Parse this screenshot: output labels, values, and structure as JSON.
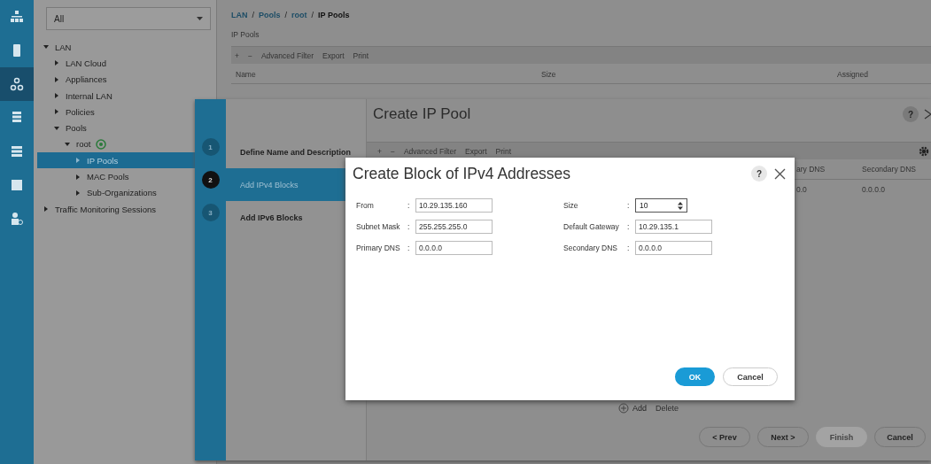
{
  "nav_icons": [
    {
      "selected": false
    },
    {
      "selected": false
    },
    {
      "selected": true
    },
    {
      "selected": false
    },
    {
      "selected": false
    },
    {
      "selected": false
    },
    {
      "selected": false
    }
  ],
  "filter": {
    "value": "All"
  },
  "tree": [
    {
      "label": "LAN",
      "expanded": true,
      "selected": false,
      "children": [
        {
          "label": "LAN Cloud",
          "expanded": false,
          "selected": false
        },
        {
          "label": "Appliances",
          "expanded": false,
          "selected": false
        },
        {
          "label": "Internal LAN",
          "expanded": false,
          "selected": false
        },
        {
          "label": "Policies",
          "expanded": false,
          "selected": false
        },
        {
          "label": "Pools",
          "expanded": true,
          "selected": false,
          "children": [
            {
              "label": "root",
              "expanded": true,
              "selected": false,
              "kind": "org",
              "children": [
                {
                  "label": "IP Pools",
                  "expanded": false,
                  "selected": true
                },
                {
                  "label": "MAC Pools",
                  "expanded": false,
                  "selected": false
                },
                {
                  "label": "Sub-Organizations",
                  "expanded": false,
                  "selected": false
                }
              ]
            }
          ]
        }
      ]
    },
    {
      "label": "Traffic Monitoring Sessions",
      "expanded": false,
      "selected": false
    }
  ],
  "breadcrumb": [
    "LAN",
    "Pools",
    "root",
    "IP Pools"
  ],
  "breadcrumb_separator": "/",
  "section_title": "IP Pools",
  "toolbar": {
    "add": "+",
    "remove": "−",
    "filter": "Advanced Filter",
    "export": "Export",
    "print": "Print"
  },
  "table": {
    "columns": [
      "Name",
      "Size",
      "Assigned"
    ]
  },
  "wizard": {
    "title": "Create IP Pool",
    "help": "?",
    "steps": [
      {
        "number": "1",
        "label": "Define Name and Description",
        "selected": false
      },
      {
        "number": "2",
        "label": "Add IPv4 Blocks",
        "selected": true
      },
      {
        "number": "3",
        "label": "Add IPv6 Blocks",
        "selected": false
      }
    ],
    "toolbar": {
      "add": "+",
      "remove": "−",
      "filter": "Advanced Filter",
      "export": "Export",
      "print": "Print"
    },
    "columns": [
      "ary DNS",
      "Secondary DNS"
    ],
    "row": [
      "0.0",
      "0.0.0.0"
    ],
    "add": "Add",
    "delete": "Delete",
    "buttons": [
      {
        "label": "< Prev",
        "disabled": false
      },
      {
        "label": "Next >",
        "disabled": false
      },
      {
        "label": "Finish",
        "disabled": true
      },
      {
        "label": "Cancel",
        "disabled": false
      }
    ]
  },
  "dialog": {
    "title": "Create Block of IPv4 Addresses",
    "help": "?",
    "fields": [
      {
        "label": "From",
        "value": "10.29.135.160",
        "kind": "text"
      },
      {
        "label": "Size",
        "value": "10",
        "kind": "spinner"
      },
      {
        "label": "Subnet Mask",
        "value": "255.255.255.0",
        "kind": "text"
      },
      {
        "label": "Default Gateway",
        "value": "10.29.135.1",
        "kind": "text"
      },
      {
        "label": "Primary DNS",
        "value": "0.0.0.0",
        "kind": "text"
      },
      {
        "label": "Secondary DNS",
        "value": "0.0.0.0",
        "kind": "text"
      }
    ],
    "separator": ":",
    "ok": "OK",
    "cancel": "Cancel"
  }
}
